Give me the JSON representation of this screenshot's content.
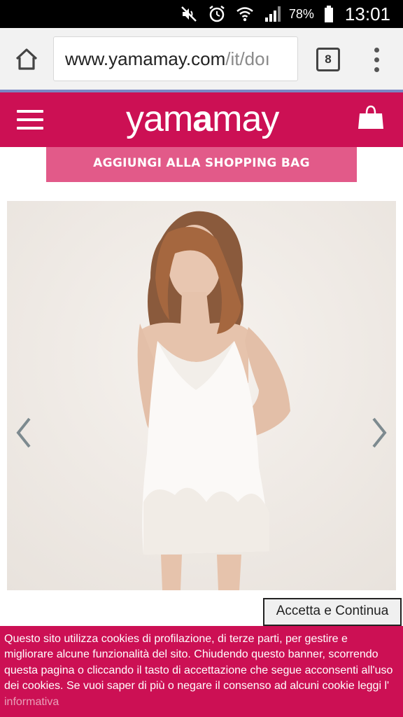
{
  "status_bar": {
    "battery_percent": "78%",
    "time": "13:01",
    "icons": [
      "mute-icon",
      "alarm-icon",
      "wifi-icon",
      "signal-icon",
      "battery-icon"
    ]
  },
  "browser": {
    "url_domain": "www.yamamay.com",
    "url_path": "/it/doı",
    "tab_count": "8"
  },
  "header": {
    "logo_pre": "yam",
    "logo_bold": "a",
    "logo_post": "may",
    "color": "#cc1054"
  },
  "product": {
    "add_to_bag_label": "AGGIUNGI ALLA SHOPPING BAG"
  },
  "cookie": {
    "accept_label": "Accetta e Continua",
    "text": "Questo sito utilizza cookies di profilazione, di terze parti, per gestire e migliorare alcune funzionalità del sito. Chiudendo questo banner, scorrendo questa pagina o cliccando il tasto di accettazione che segue acconsenti all'uso dei cookies. Se vuoi saper di più o negare il consenso ad alcuni cookie leggi l'",
    "link_label": "informativa"
  },
  "colors": {
    "brand": "#cc1054",
    "button_pink": "#e25a89",
    "accent_line": "#7a86c4"
  }
}
